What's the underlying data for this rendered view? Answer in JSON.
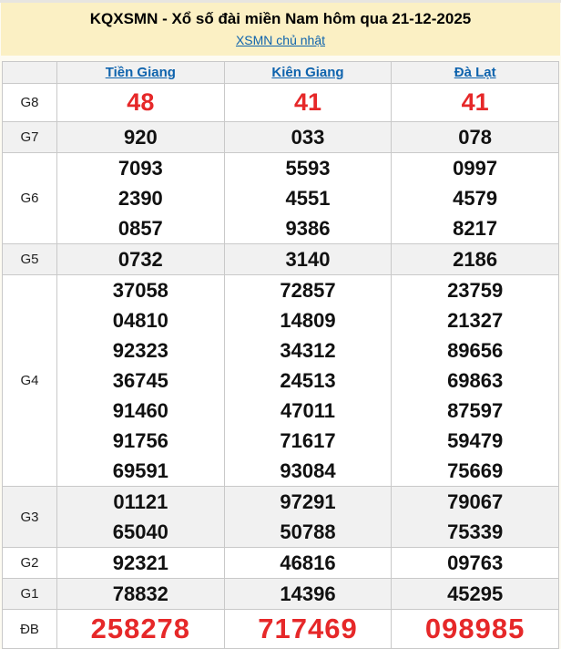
{
  "header": {
    "title": "KQXSMN - Xổ số đài miền Nam hôm qua 21-12-2025",
    "subtitle_link": "XSMN chủ nhật"
  },
  "table": {
    "columns": [
      "Tiền Giang",
      "Kiên Giang",
      "Đà Lạt"
    ],
    "rows": [
      {
        "prize": "G8",
        "highlight": true,
        "big": false,
        "values": [
          [
            "48"
          ],
          [
            "41"
          ],
          [
            "41"
          ]
        ]
      },
      {
        "prize": "G7",
        "highlight": false,
        "big": false,
        "values": [
          [
            "920"
          ],
          [
            "033"
          ],
          [
            "078"
          ]
        ]
      },
      {
        "prize": "G6",
        "highlight": false,
        "big": false,
        "values": [
          [
            "7093",
            "2390",
            "0857"
          ],
          [
            "5593",
            "4551",
            "9386"
          ],
          [
            "0997",
            "4579",
            "8217"
          ]
        ]
      },
      {
        "prize": "G5",
        "highlight": false,
        "big": false,
        "values": [
          [
            "0732"
          ],
          [
            "3140"
          ],
          [
            "2186"
          ]
        ]
      },
      {
        "prize": "G4",
        "highlight": false,
        "big": false,
        "values": [
          [
            "37058",
            "04810",
            "92323",
            "36745",
            "91460",
            "91756",
            "69591"
          ],
          [
            "72857",
            "14809",
            "34312",
            "24513",
            "47011",
            "71617",
            "93084"
          ],
          [
            "23759",
            "21327",
            "89656",
            "69863",
            "87597",
            "59479",
            "75669"
          ]
        ]
      },
      {
        "prize": "G3",
        "highlight": false,
        "big": false,
        "values": [
          [
            "01121",
            "65040"
          ],
          [
            "97291",
            "50788"
          ],
          [
            "79067",
            "75339"
          ]
        ]
      },
      {
        "prize": "G2",
        "highlight": false,
        "big": false,
        "values": [
          [
            "92321"
          ],
          [
            "46816"
          ],
          [
            "09763"
          ]
        ]
      },
      {
        "prize": "G1",
        "highlight": false,
        "big": false,
        "values": [
          [
            "78832"
          ],
          [
            "14396"
          ],
          [
            "45295"
          ]
        ]
      },
      {
        "prize": "ĐB",
        "highlight": true,
        "big": true,
        "values": [
          [
            "258278"
          ],
          [
            "717469"
          ],
          [
            "098985"
          ]
        ]
      }
    ]
  },
  "colors": {
    "accent_red": "#e62829",
    "link_blue": "#0e63ad",
    "header_background": "#fbf0c4",
    "row_shade": "#f1f1f1",
    "border": "#c9c9c9"
  }
}
